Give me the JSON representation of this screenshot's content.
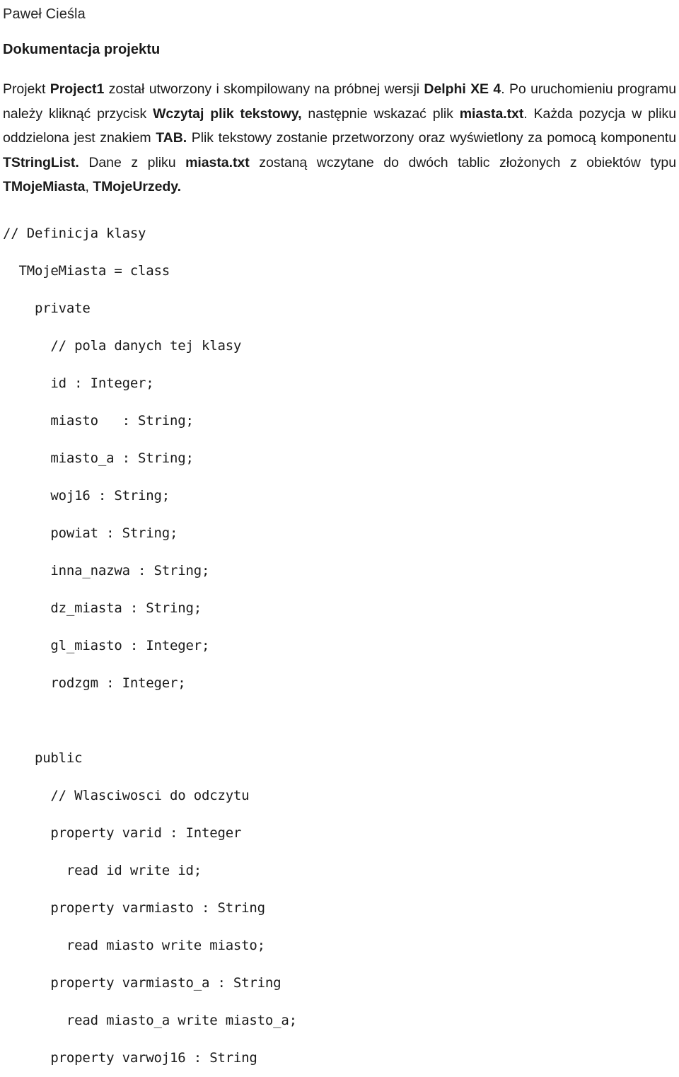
{
  "header": {
    "author": "Paweł Cieśla",
    "doc_title": "Dokumentacja projektu"
  },
  "intro": {
    "segments": [
      {
        "text": "Projekt ",
        "bold": false
      },
      {
        "text": "Project1",
        "bold": true
      },
      {
        "text": " został utworzony i skompilowany na próbnej wersji ",
        "bold": false
      },
      {
        "text": "Delphi XE 4",
        "bold": true
      },
      {
        "text": ". Po uruchomieniu programu należy kliknąć przycisk ",
        "bold": false
      },
      {
        "text": "Wczytaj plik tekstowy,",
        "bold": true
      },
      {
        "text": " następnie wskazać plik ",
        "bold": false
      },
      {
        "text": "miasta.txt",
        "bold": true
      },
      {
        "text": ".  Każda pozycja w pliku oddzielona jest znakiem ",
        "bold": false
      },
      {
        "text": "TAB.",
        "bold": true
      },
      {
        "text": " Plik tekstowy  zostanie przetworzony oraz wyświetlony za pomocą komponentu ",
        "bold": false
      },
      {
        "text": "TStringList.",
        "bold": true
      },
      {
        "text": " Dane z pliku ",
        "bold": false
      },
      {
        "text": "miasta.txt",
        "bold": true
      },
      {
        "text": " zostaną wczytane do dwóch tablic złożonych  z  obiektów typu ",
        "bold": false
      },
      {
        "text": "TMojeMiasta",
        "bold": true
      },
      {
        "text": ", ",
        "bold": false
      },
      {
        "text": "TMojeUrzedy.",
        "bold": true
      }
    ]
  },
  "code": {
    "lines": [
      "// Definicja klasy",
      "  TMojeMiasta = class",
      "    private",
      "      // pola danych tej klasy",
      "      id : Integer;",
      "      miasto   : String;",
      "      miasto_a : String;",
      "      woj16 : String;",
      "      powiat : String;",
      "      inna_nazwa : String;",
      "      dz_miasta : String;",
      "      gl_miasto : Integer;",
      "      rodzgm : Integer;",
      "",
      "    public",
      "      // Wlasciwosci do odczytu",
      "      property varid : Integer",
      "        read id write id;",
      "      property varmiasto : String",
      "        read miasto write miasto;",
      "      property varmiasto_a : String",
      "        read miasto_a write miasto_a;",
      "      property varwoj16 : String"
    ]
  }
}
